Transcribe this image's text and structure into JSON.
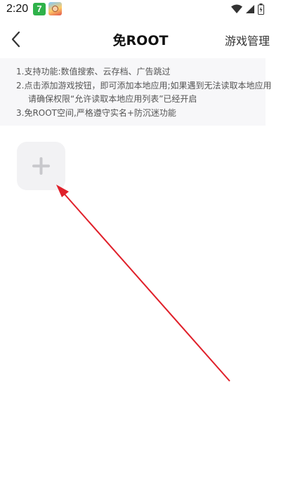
{
  "status_bar": {
    "time": "2:20",
    "app_icon_1_text": "7",
    "icons": [
      "wifi-icon",
      "signal-icon",
      "battery-icon"
    ]
  },
  "header": {
    "title": "免ROOT",
    "right_link": "游戏管理",
    "back_icon": "chevron-left-icon"
  },
  "notice": {
    "lines": [
      "1.支持功能:数值搜索、云存档、广告跳过",
      "2.点击添加游戏按钮，即可添加本地应用;如果遇到无法读取本地应用",
      "请确保权限“允许读取本地应用列表”已经开启",
      "3.免ROOT空间,严格遵守实名+防沉迷功能"
    ]
  },
  "add_tile": {
    "icon": "plus-icon"
  },
  "colors": {
    "annotation_arrow": "#e0202a",
    "notice_bg": "#f7f7f9",
    "tile_bg": "#f2f2f4",
    "plus": "#c8c8cc"
  }
}
